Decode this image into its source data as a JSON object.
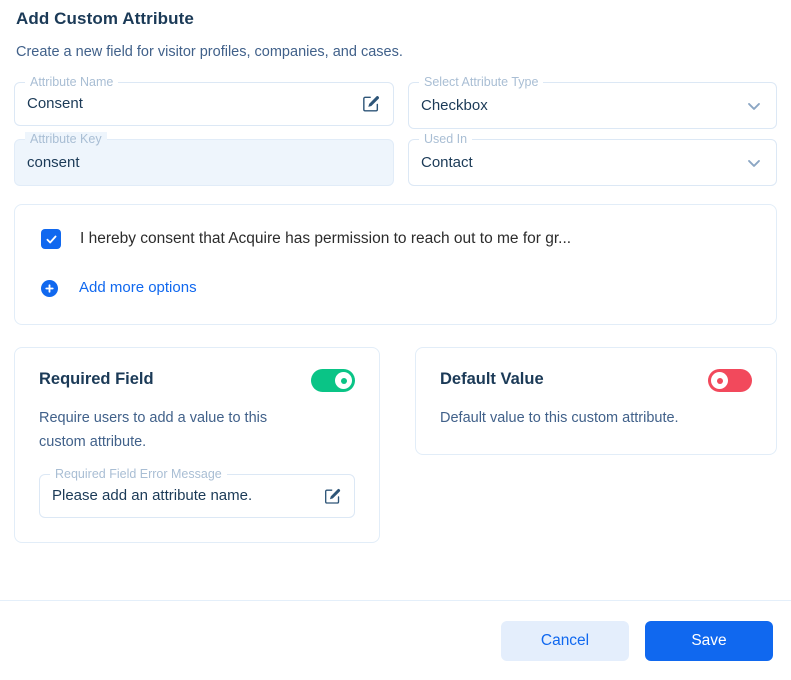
{
  "dialog": {
    "title": "Add Custom Attribute",
    "subtitle": "Create a new field for visitor profiles, companies, and cases."
  },
  "fields": {
    "attribute_name": {
      "label": "Attribute Name",
      "value": "Consent",
      "placeholder": "Attribute Name",
      "icon": "edit-pencil-icon"
    },
    "attribute_type": {
      "label": "Select Attribute Type",
      "value": "Checkbox",
      "icon": "chevron-down-icon"
    },
    "attribute_key": {
      "label": "Attribute Key",
      "value": "consent",
      "placeholder": "Attribute Key",
      "readonly": true
    },
    "used_in": {
      "label": "Used In",
      "value": "Contact",
      "icon": "chevron-down-icon"
    }
  },
  "options_card": {
    "option": {
      "label": "I hereby consent that Acquire has permission to reach out to me for gr...",
      "checked": true
    },
    "add_more_label": "Add more options"
  },
  "required_field_panel": {
    "title": "Required Field",
    "description": "Require users to add a value to this custom attribute.",
    "toggle_state": "on",
    "error_message_field": {
      "label": "Required Field Error Message",
      "value": "Please add an attribute name.",
      "placeholder": "Required Field Error Message",
      "icon": "edit-pencil-icon"
    }
  },
  "default_value_panel": {
    "title": "Default Value",
    "description": "Default value to this custom attribute.",
    "toggle_state": "off"
  },
  "footer": {
    "cancel_label": "Cancel",
    "save_label": "Save"
  },
  "colors": {
    "primary_blue": "#1068ef",
    "toggle_on_green": "#0ac486",
    "toggle_off_red": "#f2495c",
    "title_navy": "#1b3a57",
    "readonly_bg": "#eef5fc"
  }
}
